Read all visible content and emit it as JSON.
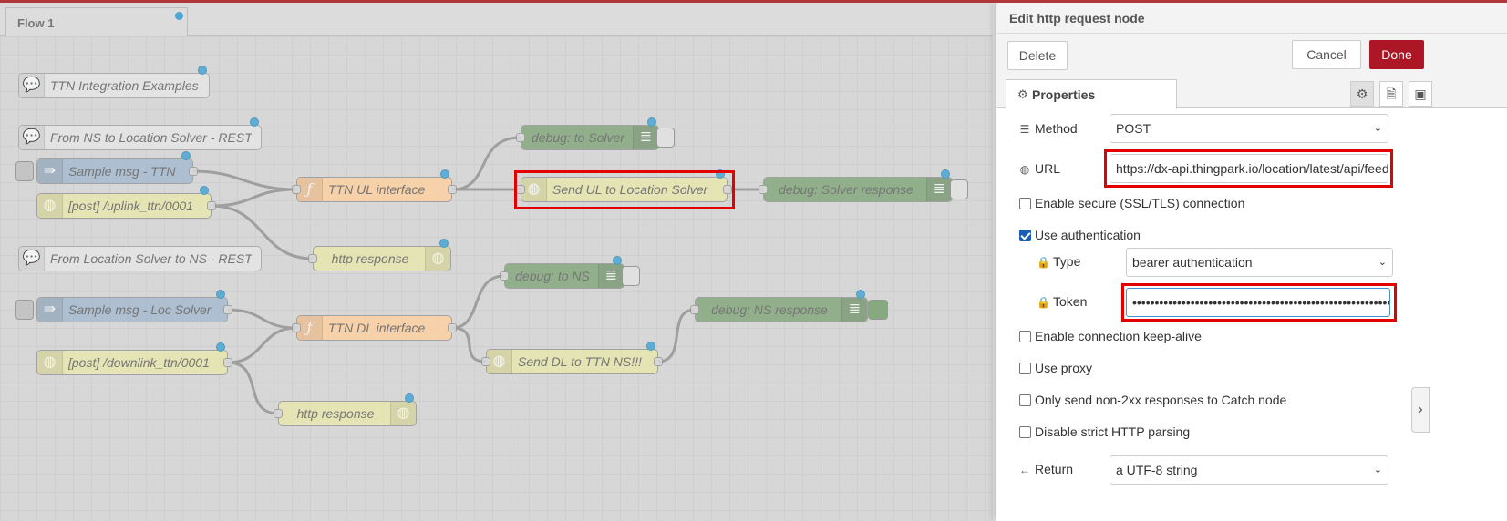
{
  "workspace": {
    "tab_label": "Flow 1",
    "nodes": {
      "c1": "TTN Integration Examples",
      "c2": "From NS to Location Solver - REST",
      "inj1": "Sample msg - TTN",
      "http1": "[post] /uplink_ttn/0001",
      "func1": "TTN UL interface",
      "dbg1": "debug: to Solver",
      "req1": "Send UL to Location Solver",
      "dbg2": "debug: Solver response",
      "c3": "From Location Solver to NS - REST",
      "resp1": "http response",
      "dbg3": "debug: to NS",
      "inj2": "Sample msg - Loc Solver",
      "func2": "TTN DL interface",
      "dbg4": "debug: NS response",
      "http2": "[post] /downlink_ttn/0001",
      "req2": "Send DL to TTN NS!!!",
      "resp2": "http response"
    }
  },
  "tray": {
    "title": "Edit http request node",
    "delete_label": "Delete",
    "cancel_label": "Cancel",
    "done_label": "Done",
    "properties_tab": "Properties",
    "method": {
      "label": "Method",
      "value": "POST"
    },
    "url": {
      "label": "URL",
      "value": "https://dx-api.thingpark.io/location/latest/api/feeds"
    },
    "ssl": {
      "label": "Enable secure (SSL/TLS) connection",
      "checked": false
    },
    "auth": {
      "label": "Use authentication",
      "checked": true
    },
    "auth_type": {
      "label": "Type",
      "value": "bearer authentication"
    },
    "token": {
      "label": "Token",
      "value": "•••••••••••••••••••••••••••••••••••••••••••••••••••••••••••"
    },
    "keepalive": {
      "label": "Enable connection keep-alive",
      "checked": false
    },
    "proxy": {
      "label": "Use proxy",
      "checked": false
    },
    "catch": {
      "label": "Only send non-2xx responses to Catch node",
      "checked": false
    },
    "strict": {
      "label": "Disable strict HTTP parsing",
      "checked": false
    },
    "return": {
      "label": "Return",
      "value": "a UTF-8 string"
    }
  },
  "colors": {
    "accent": "#ad1625",
    "highlight": "#e30000",
    "status_dot": "#4aa6d4"
  }
}
